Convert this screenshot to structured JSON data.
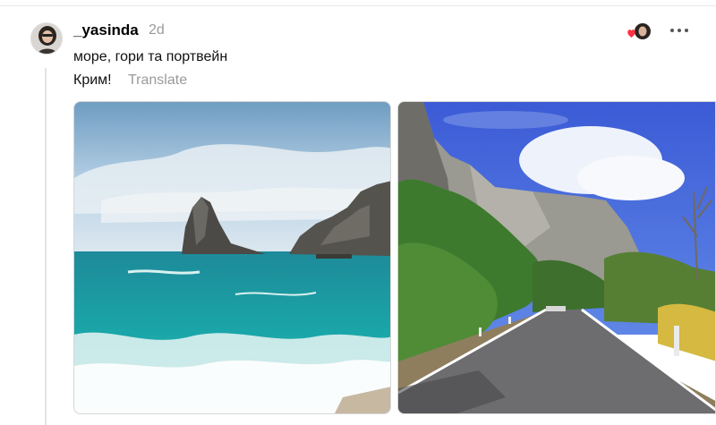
{
  "post": {
    "username": "_yasinda",
    "timestamp": "2d",
    "text_line1": "море, гори та портвейн",
    "text_line2": "Крим!",
    "translate_label": "Translate"
  },
  "icons": {
    "likers": "heart-with-avatar-icon",
    "more": "more-horizontal-icon"
  },
  "colors": {
    "heart": "#ff3040",
    "muted": "#9a9a9a",
    "thread_line": "#e3e3e3"
  }
}
